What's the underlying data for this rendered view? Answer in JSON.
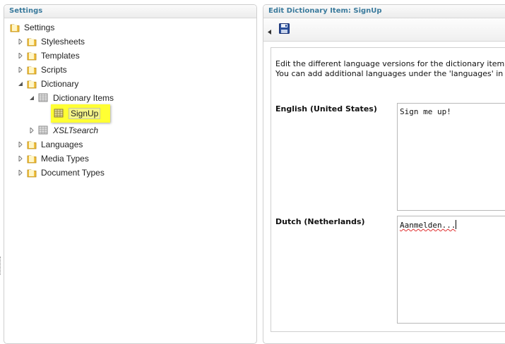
{
  "left_panel": {
    "title": "Settings",
    "tree": {
      "root": {
        "label": "Settings",
        "icon": "folder-icon"
      },
      "items": [
        {
          "label": "Stylesheets",
          "icon": "folder-icon",
          "expanded": false
        },
        {
          "label": "Templates",
          "icon": "folder-icon",
          "expanded": false
        },
        {
          "label": "Scripts",
          "icon": "folder-icon",
          "expanded": false
        },
        {
          "label": "Dictionary",
          "icon": "folder-icon",
          "expanded": true
        }
      ],
      "dictionary_items": {
        "label": "Dictionary Items",
        "icon": "dictionary-icon",
        "expanded": true
      },
      "signup": {
        "label": "SignUp",
        "icon": "dictionary-icon",
        "selected": true
      },
      "xsltsearch": {
        "label": "XSLTsearch",
        "icon": "dictionary-icon",
        "expanded": false
      },
      "after": [
        {
          "label": "Languages",
          "icon": "folder-icon"
        },
        {
          "label": "Media Types",
          "icon": "folder-icon"
        },
        {
          "label": "Document Types",
          "icon": "folder-icon"
        }
      ]
    }
  },
  "right_panel": {
    "title": "Edit Dictionary Item: SignUp",
    "toolbar": {
      "save_icon": "save-icon"
    },
    "intro_line1": "Edit the different language versions for the dictionary item",
    "intro_line2": "You can add additional languages under the 'languages' in t",
    "languages": [
      {
        "label": "English (United States)",
        "value": "Sign me up!"
      },
      {
        "label": "Dutch (Netherlands)",
        "value": "Aanmelden..."
      }
    ]
  },
  "colors": {
    "header_text": "#3a7a9c",
    "highlight": "#ffff33",
    "spellcheck": "#e03030"
  }
}
